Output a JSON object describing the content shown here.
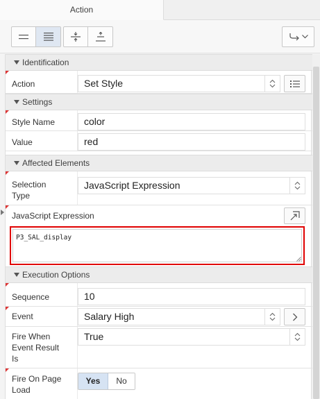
{
  "tab": {
    "label": "Action"
  },
  "toolbar": {
    "buttons": [
      "collapse-rows",
      "expand-rows",
      "collapse-all",
      "expand-all"
    ],
    "menu_icon": "go-to-group-icon"
  },
  "sections": {
    "identification": "Identification",
    "settings": "Settings",
    "affected": "Affected Elements",
    "execution": "Execution Options"
  },
  "fields": {
    "action": {
      "label": "Action",
      "value": "Set Style"
    },
    "style_name": {
      "label": "Style Name",
      "value": "color"
    },
    "value": {
      "label": "Value",
      "value": "red"
    },
    "selection_type": {
      "label": "Selection\nType",
      "value": "JavaScript Expression"
    },
    "js_expression": {
      "label": "JavaScript Expression",
      "value": "P3_SAL_display"
    },
    "sequence": {
      "label": "Sequence",
      "value": "10"
    },
    "event": {
      "label": "Event",
      "value": "Salary High"
    },
    "fire_when": {
      "label": "Fire When\nEvent Result\nIs",
      "value": "True"
    },
    "fire_on_load": {
      "label": "Fire On Page\nLoad",
      "yes": "Yes",
      "no": "No",
      "selected": "Yes"
    }
  }
}
